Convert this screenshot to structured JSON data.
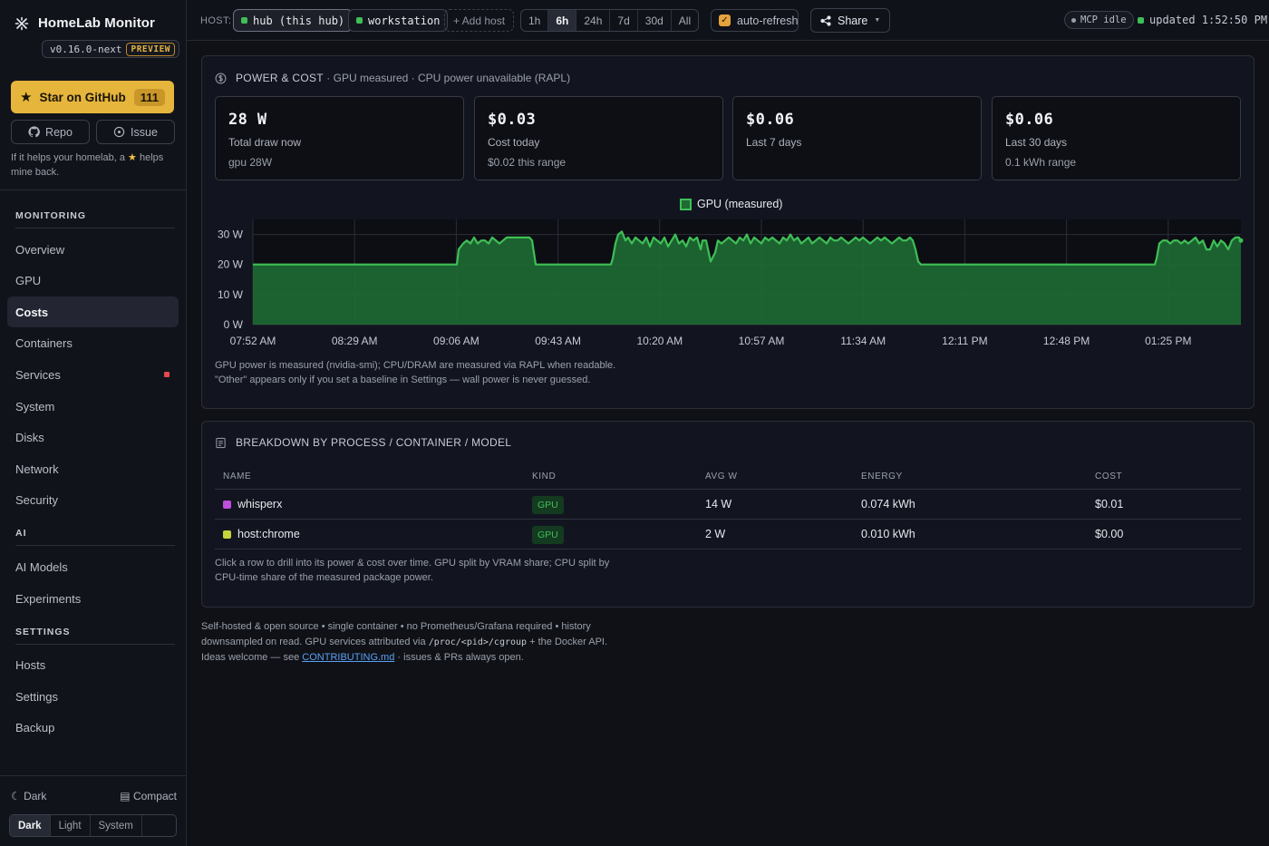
{
  "app": {
    "title": "HomeLab Monitor",
    "version": "v0.16.0-next",
    "preview": "PREVIEW"
  },
  "sidebar": {
    "github_label": "Star on GitHub",
    "github_stars": "111",
    "repo_label": "Repo",
    "issue_label": "Issue",
    "help_pre": "If it helps your homelab, a",
    "help_post": "helps mine back.",
    "sections": [
      {
        "title": "MONITORING",
        "items": [
          "Overview",
          "GPU",
          "Costs",
          "Containers",
          "Services",
          "System",
          "Disks",
          "Network",
          "Security"
        ]
      },
      {
        "title": "AI",
        "items": [
          "AI Models",
          "Experiments"
        ]
      },
      {
        "title": "SETTINGS",
        "items": [
          "Hosts",
          "Settings",
          "Backup"
        ]
      }
    ],
    "active_item": "Costs",
    "alert_item": "Services",
    "theme_label": "Dark",
    "compact_label": "Compact",
    "theme_options": [
      "Dark",
      "Light",
      "System"
    ],
    "theme_selected": "Dark"
  },
  "topbar": {
    "host_label": "HOST:",
    "hosts": [
      "hub (this hub)",
      "workstation"
    ],
    "add_host": "+ Add host",
    "ranges": [
      "1h",
      "6h",
      "24h",
      "7d",
      "30d",
      "All"
    ],
    "range_selected": "6h",
    "auto_refresh": "auto-refresh",
    "share": "Share",
    "mcp": "MCP idle",
    "updated": "updated 1:52:50 PM"
  },
  "power": {
    "title": "POWER & COST",
    "subtitle": "· GPU measured · CPU power unavailable (RAPL)",
    "cards": [
      {
        "value": "28 W",
        "label": "Total draw now",
        "sub": "gpu 28W"
      },
      {
        "value": "$0.03",
        "label": "Cost today",
        "sub": "$0.02 this range"
      },
      {
        "value": "$0.06",
        "label": "Last 7 days",
        "sub": ""
      },
      {
        "value": "$0.06",
        "label": "Last 30 days",
        "sub": "0.1 kWh range"
      }
    ],
    "note": "GPU power is measured (nvidia-smi); CPU/DRAM are measured via RAPL when readable. \"Other\" appears only if you set a baseline in Settings — wall power is never guessed."
  },
  "chart_data": {
    "type": "area",
    "series": [
      {
        "name": "GPU (measured)",
        "color": "#3fbf56",
        "points": [
          [
            0,
            20
          ],
          [
            20,
            20
          ],
          [
            40,
            20
          ],
          [
            60,
            20
          ],
          [
            80,
            20
          ],
          [
            100,
            20
          ],
          [
            120,
            20
          ],
          [
            140,
            20
          ],
          [
            160,
            20
          ],
          [
            180,
            20
          ],
          [
            200,
            20
          ],
          [
            220,
            20
          ],
          [
            225,
            20
          ],
          [
            227,
            25
          ],
          [
            232,
            27
          ],
          [
            236,
            28
          ],
          [
            240,
            27
          ],
          [
            244,
            29
          ],
          [
            248,
            27
          ],
          [
            252,
            28
          ],
          [
            256,
            28
          ],
          [
            260,
            27
          ],
          [
            264,
            29
          ],
          [
            268,
            28
          ],
          [
            272,
            27
          ],
          [
            276,
            28
          ],
          [
            280,
            29
          ],
          [
            290,
            29
          ],
          [
            300,
            29
          ],
          [
            305,
            29
          ],
          [
            308,
            28
          ],
          [
            312,
            20
          ],
          [
            330,
            20
          ],
          [
            350,
            20
          ],
          [
            370,
            20
          ],
          [
            390,
            20
          ],
          [
            395,
            20
          ],
          [
            397,
            22
          ],
          [
            400,
            27
          ],
          [
            403,
            30
          ],
          [
            407,
            31
          ],
          [
            411,
            28
          ],
          [
            414,
            29
          ],
          [
            418,
            27
          ],
          [
            422,
            29
          ],
          [
            426,
            28
          ],
          [
            430,
            27
          ],
          [
            434,
            29
          ],
          [
            438,
            26
          ],
          [
            442,
            29
          ],
          [
            446,
            28
          ],
          [
            450,
            27
          ],
          [
            454,
            29
          ],
          [
            458,
            26
          ],
          [
            462,
            28
          ],
          [
            466,
            30
          ],
          [
            470,
            27
          ],
          [
            474,
            28
          ],
          [
            478,
            26
          ],
          [
            482,
            29
          ],
          [
            486,
            28
          ],
          [
            490,
            29
          ],
          [
            494,
            25
          ],
          [
            496,
            28
          ],
          [
            500,
            28
          ],
          [
            505,
            21
          ],
          [
            510,
            24
          ],
          [
            513,
            28
          ],
          [
            517,
            27
          ],
          [
            521,
            28
          ],
          [
            525,
            29
          ],
          [
            529,
            28
          ],
          [
            533,
            27
          ],
          [
            537,
            29
          ],
          [
            541,
            28
          ],
          [
            545,
            30
          ],
          [
            549,
            27
          ],
          [
            553,
            29
          ],
          [
            557,
            28
          ],
          [
            561,
            27
          ],
          [
            565,
            29
          ],
          [
            569,
            28
          ],
          [
            573,
            29
          ],
          [
            577,
            28
          ],
          [
            581,
            27
          ],
          [
            585,
            29
          ],
          [
            589,
            28
          ],
          [
            593,
            30
          ],
          [
            597,
            28
          ],
          [
            601,
            29
          ],
          [
            605,
            27
          ],
          [
            609,
            28
          ],
          [
            613,
            29
          ],
          [
            617,
            27
          ],
          [
            621,
            28
          ],
          [
            625,
            29
          ],
          [
            629,
            28
          ],
          [
            633,
            27
          ],
          [
            637,
            29
          ],
          [
            641,
            28
          ],
          [
            645,
            28
          ],
          [
            649,
            29
          ],
          [
            653,
            28
          ],
          [
            657,
            27
          ],
          [
            661,
            28
          ],
          [
            665,
            29
          ],
          [
            669,
            28
          ],
          [
            673,
            29
          ],
          [
            677,
            28
          ],
          [
            681,
            27
          ],
          [
            685,
            28
          ],
          [
            689,
            29
          ],
          [
            693,
            28
          ],
          [
            697,
            29
          ],
          [
            701,
            28
          ],
          [
            705,
            27
          ],
          [
            709,
            28
          ],
          [
            713,
            29
          ],
          [
            717,
            28
          ],
          [
            721,
            28
          ],
          [
            725,
            29
          ],
          [
            728,
            28
          ],
          [
            731,
            25
          ],
          [
            734,
            21
          ],
          [
            737,
            20
          ],
          [
            760,
            20
          ],
          [
            800,
            20
          ],
          [
            840,
            20
          ],
          [
            880,
            20
          ],
          [
            920,
            20
          ],
          [
            960,
            20
          ],
          [
            995,
            20
          ],
          [
            997,
            22
          ],
          [
            1000,
            27
          ],
          [
            1004,
            28
          ],
          [
            1008,
            28
          ],
          [
            1012,
            27
          ],
          [
            1016,
            28
          ],
          [
            1020,
            28
          ],
          [
            1024,
            27
          ],
          [
            1028,
            28
          ],
          [
            1032,
            27
          ],
          [
            1036,
            28
          ],
          [
            1040,
            29
          ],
          [
            1044,
            27
          ],
          [
            1048,
            28
          ],
          [
            1052,
            25
          ],
          [
            1056,
            25
          ],
          [
            1060,
            28
          ],
          [
            1064,
            26
          ],
          [
            1068,
            28
          ],
          [
            1072,
            27
          ],
          [
            1076,
            25
          ],
          [
            1080,
            28
          ],
          [
            1084,
            29
          ],
          [
            1088,
            29
          ],
          [
            1090,
            28
          ]
        ]
      }
    ],
    "legend": "GPU (measured)",
    "x_ticks": [
      "07:52 AM",
      "08:29 AM",
      "09:06 AM",
      "09:43 AM",
      "10:20 AM",
      "10:57 AM",
      "11:34 AM",
      "12:11 PM",
      "12:48 PM",
      "01:25 PM"
    ],
    "y_ticks": [
      "0 W",
      "10 W",
      "20 W",
      "30 W"
    ],
    "ylim": [
      0,
      35
    ]
  },
  "breakdown": {
    "title": "BREAKDOWN BY PROCESS / CONTAINER / MODEL",
    "columns": [
      "NAME",
      "KIND",
      "AVG W",
      "ENERGY",
      "COST"
    ],
    "rows": [
      {
        "name": "whisperx",
        "color": "#c04fdc",
        "kind": "GPU",
        "avg": "14 W",
        "energy": "0.074 kWh",
        "cost": "$0.01"
      },
      {
        "name": "host:chrome",
        "color": "#c5d43a",
        "kind": "GPU",
        "avg": "2 W",
        "energy": "0.010 kWh",
        "cost": "$0.00"
      }
    ],
    "note": "Click a row to drill into its power & cost over time. GPU split by VRAM share; CPU split by CPU-time share of the measured package power."
  },
  "footer": {
    "line1": "Self-hosted & open source • single container • no Prometheus/Grafana required • history",
    "line2_pre": "downsampled on read. GPU services attributed via",
    "line2_code": "/proc/<pid>/cgroup",
    "line2_post": "+ the Docker API.",
    "line3_pre": "Ideas welcome — see",
    "line3_link": "CONTRIBUTING.md",
    "line3_post": "· issues & PRs always open."
  }
}
